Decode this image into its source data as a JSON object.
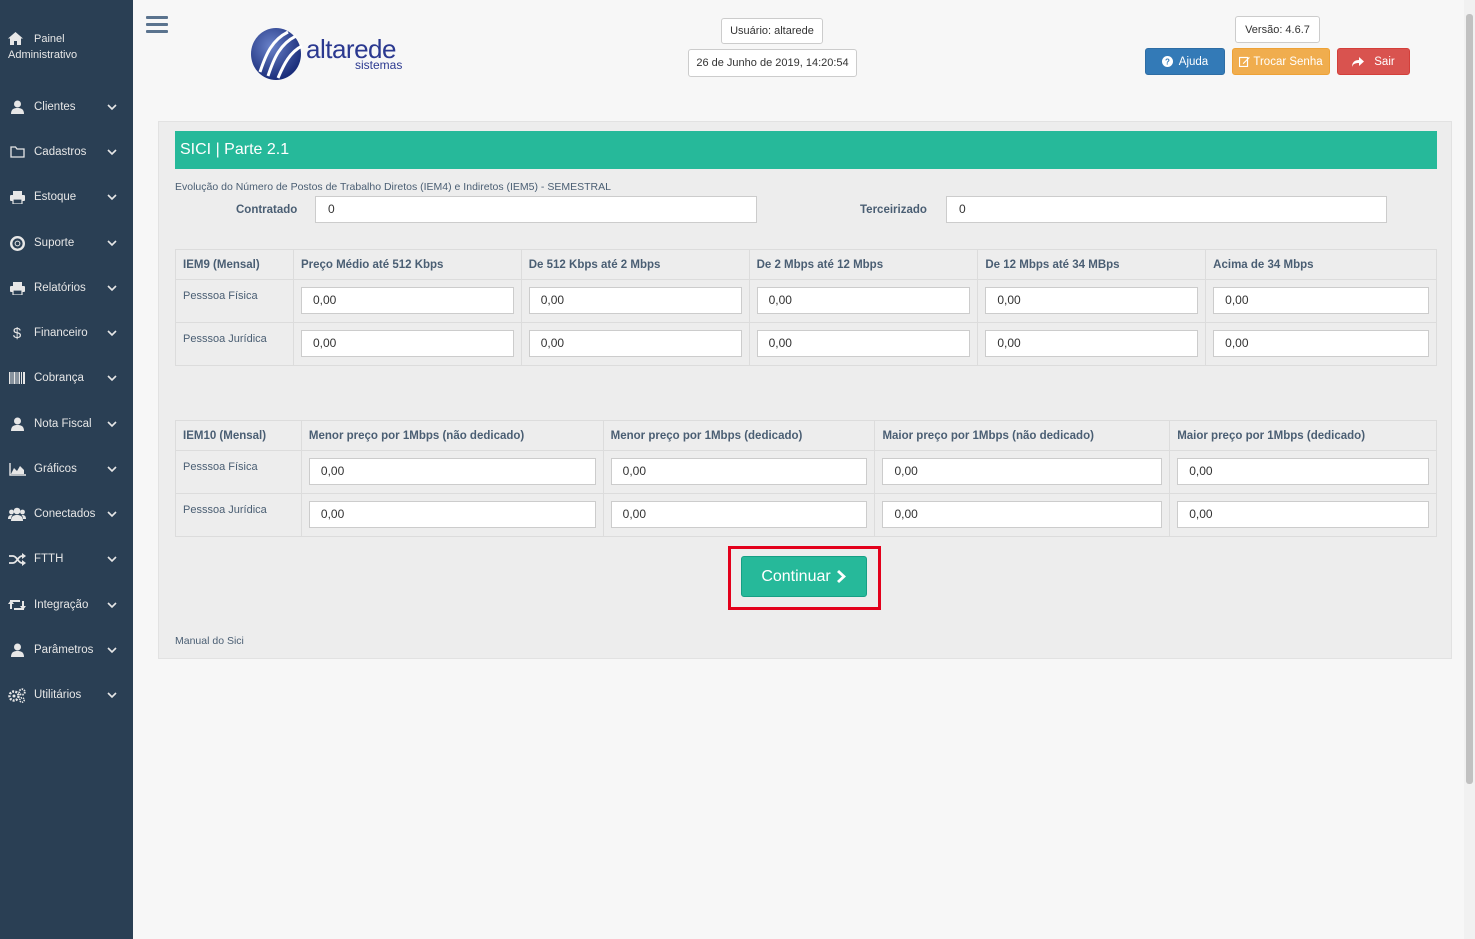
{
  "sidebar": {
    "home": {
      "label_line1": "Painel",
      "label_line2": "Administrativo",
      "icon": "home-icon"
    },
    "items": [
      {
        "label": "Clientes",
        "icon": "user-icon"
      },
      {
        "label": "Cadastros",
        "icon": "folder-icon"
      },
      {
        "label": "Estoque",
        "icon": "print-icon"
      },
      {
        "label": "Suporte",
        "icon": "life-ring-icon"
      },
      {
        "label": "Relatórios",
        "icon": "print-icon"
      },
      {
        "label": "Financeiro",
        "icon": "dollar-icon"
      },
      {
        "label": "Cobrança",
        "icon": "barcode-icon"
      },
      {
        "label": "Nota Fiscal",
        "icon": "user-icon"
      },
      {
        "label": "Gráficos",
        "icon": "area-chart-icon"
      },
      {
        "label": "Conectados",
        "icon": "users-icon"
      },
      {
        "label": "FTTH",
        "icon": "random-icon"
      },
      {
        "label": "Integração",
        "icon": "retweet-icon"
      },
      {
        "label": "Parâmetros",
        "icon": "user-icon"
      },
      {
        "label": "Utilitários",
        "icon": "cogs-icon"
      }
    ]
  },
  "header": {
    "logo_main": "altarede",
    "logo_sub": "sistemas",
    "user": "Usuário: altarede",
    "datetime": "26 de Junho de 2019, 14:20:54",
    "version": "Versão: 4.6.7",
    "help_label": "Ajuda",
    "change_password_label": "Trocar Senha",
    "logout_label": "Sair"
  },
  "colors": {
    "sidebar_bg": "#2a3f54",
    "accent": "#26b99a",
    "help": "#337ab7",
    "warning": "#f0ad4e",
    "danger": "#d9534f",
    "highlight": "#e3001b"
  },
  "main": {
    "title": "SICI | Parte 2.1",
    "description": "Evolução do Número de Postos de Trabalho Diretos (IEM4) e Indiretos (IEM5) - SEMESTRAL",
    "contratado_label": "Contratado",
    "contratado_value": "0",
    "terceirizado_label": "Terceirizado",
    "terceirizado_value": "0",
    "iem9": {
      "headers": [
        "IEM9 (Mensal)",
        "Preço Médio até 512 Kbps",
        "De 512 Kbps até 2 Mbps",
        "De 2 Mbps até 12 Mbps",
        "De 12 Mbps até 34 MBps",
        "Acima de 34 Mbps"
      ],
      "rows": [
        {
          "label": "Pesssoa Física",
          "values": [
            "0,00",
            "0,00",
            "0,00",
            "0,00",
            "0,00"
          ]
        },
        {
          "label": "Pesssoa Jurídica",
          "values": [
            "0,00",
            "0,00",
            "0,00",
            "0,00",
            "0,00"
          ]
        }
      ]
    },
    "iem10": {
      "headers": [
        "IEM10 (Mensal)",
        "Menor preço por 1Mbps (não dedicado)",
        "Menor preço por 1Mbps (dedicado)",
        "Maior preço por 1Mbps (não dedicado)",
        "Maior preço por 1Mbps (dedicado)"
      ],
      "rows": [
        {
          "label": "Pesssoa Física",
          "values": [
            "0,00",
            "0,00",
            "0,00",
            "0,00"
          ]
        },
        {
          "label": "Pesssoa Jurídica",
          "values": [
            "0,00",
            "0,00",
            "0,00",
            "0,00"
          ]
        }
      ]
    },
    "continue_label": "Continuar",
    "manual_link": "Manual do Sici"
  }
}
